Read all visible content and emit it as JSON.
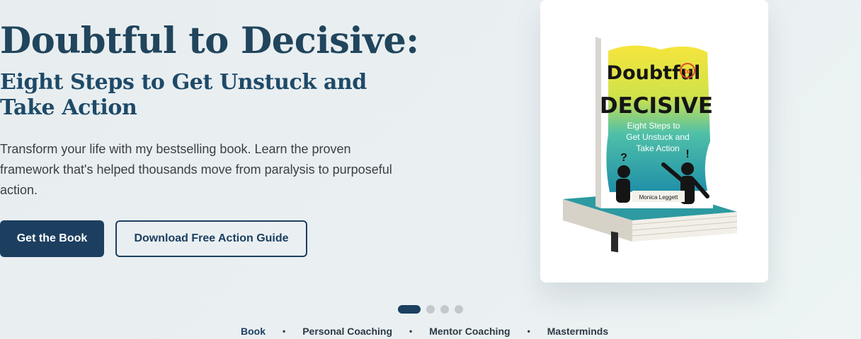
{
  "hero": {
    "title": "Doubtful to Decisive:",
    "subtitle": "Eight Steps to Get Unstuck and Take Action",
    "description": "Transform your life with my bestselling book. Learn the proven framework that's helped thousands move from paralysis to purposeful action.",
    "primary_button": "Get the Book",
    "secondary_button": "Download Free Action Guide"
  },
  "book_cover": {
    "line1": "Doubtful",
    "connector": "to",
    "line2": "DECISIVE",
    "sub1": "Eight Steps to",
    "sub2": "Get Unstuck and",
    "sub3": "Take Action",
    "author": "Monica Leggett",
    "question_mark": "?",
    "exclamation_mark": "!"
  },
  "carousel": {
    "slides": 4,
    "active_index": 0
  },
  "tabs": [
    {
      "label": "Book"
    },
    {
      "label": "Personal Coaching"
    },
    {
      "label": "Mentor Coaching"
    },
    {
      "label": "Masterminds"
    }
  ],
  "separator": "•",
  "colors": {
    "primary": "#1c3f60",
    "title": "#20455c",
    "cover_yellow": "#f5e43a",
    "cover_teal": "#2aa6a6",
    "cover_red": "#e24a2a"
  }
}
